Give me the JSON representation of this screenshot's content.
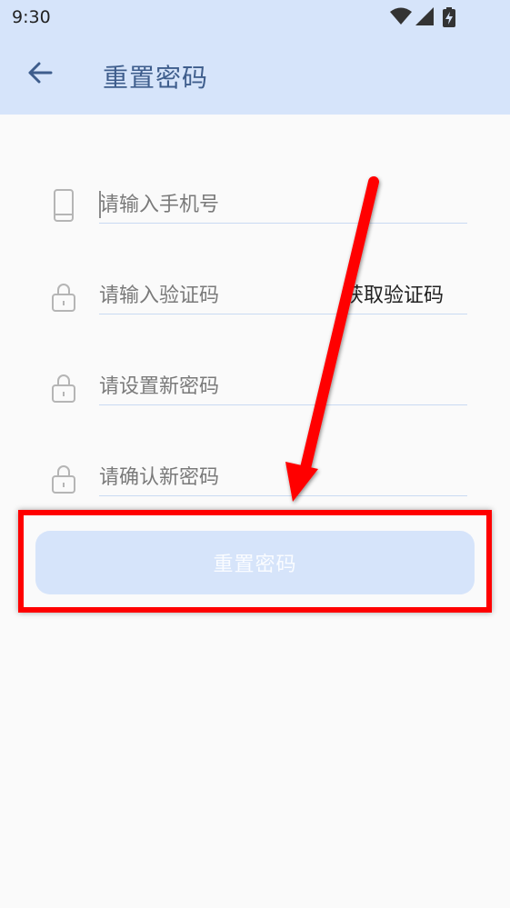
{
  "status_bar": {
    "time": "9:30",
    "icons": [
      "wifi-icon",
      "signal-icon",
      "battery-charging-icon"
    ]
  },
  "app_bar": {
    "back_icon": "arrow-left-icon",
    "title": "重置密码"
  },
  "form": {
    "phone": {
      "placeholder": "请输入手机号",
      "icon": "phone-icon"
    },
    "code": {
      "placeholder": "请输入验证码",
      "icon": "lock-icon",
      "get_code_label": "获取验证码"
    },
    "new_password": {
      "placeholder": "请设置新密码",
      "icon": "lock-icon"
    },
    "confirm_password": {
      "placeholder": "请确认新密码",
      "icon": "lock-icon"
    }
  },
  "reset_button": {
    "label": "重置密码"
  },
  "colors": {
    "header_bg": "#d6e4fa",
    "title": "#3e5d8c",
    "annotation": "#ff0000",
    "button_bg": "#d6e4fa"
  }
}
